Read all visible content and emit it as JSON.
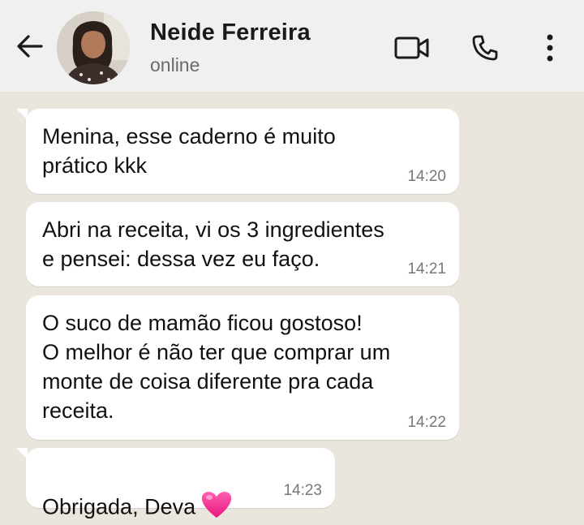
{
  "header": {
    "back_icon": "arrow-left-icon",
    "contact_name": "Neide Ferreira",
    "status": "online",
    "video_icon": "video-camera-icon",
    "call_icon": "phone-icon",
    "menu_icon": "more-vertical-icon"
  },
  "messages": [
    {
      "text": "Menina, esse caderno é muito\nprático kkk",
      "time": "14:20"
    },
    {
      "text": "Abri na receita, vi os 3 ingredientes\ne pensei: dessa vez eu faço.",
      "time": "14:21"
    },
    {
      "text": "O suco de mamão ficou gostoso!\nO melhor é não ter que comprar um\nmonte de coisa diferente pra cada\nreceita.",
      "time": "14:22"
    },
    {
      "text": "Obrigada, Deva",
      "emoji": "pink-heart-emoji",
      "time": "14:23"
    }
  ],
  "colors": {
    "header_bg": "#f0f0f0",
    "chat_bg": "#ebe6dd",
    "bubble_bg": "#ffffff",
    "heart": "#ff3c9a"
  }
}
